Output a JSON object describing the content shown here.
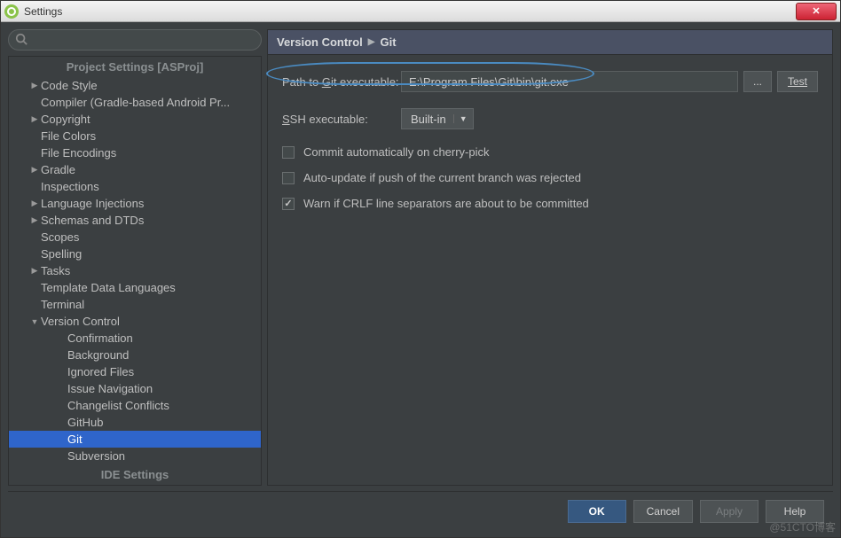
{
  "window": {
    "title": "Settings"
  },
  "search": {
    "placeholder": ""
  },
  "sidebar": {
    "section1_header": "Project Settings [ASProj]",
    "items": [
      {
        "label": "Code Style",
        "expandable": true,
        "expanded": false,
        "indent": 1
      },
      {
        "label": "Compiler (Gradle-based Android Pr...",
        "expandable": false,
        "indent": 1
      },
      {
        "label": "Copyright",
        "expandable": true,
        "expanded": false,
        "indent": 1
      },
      {
        "label": "File Colors",
        "expandable": false,
        "indent": 1
      },
      {
        "label": "File Encodings",
        "expandable": false,
        "indent": 1
      },
      {
        "label": "Gradle",
        "expandable": true,
        "expanded": false,
        "indent": 1
      },
      {
        "label": "Inspections",
        "expandable": false,
        "indent": 1
      },
      {
        "label": "Language Injections",
        "expandable": true,
        "expanded": false,
        "indent": 1
      },
      {
        "label": "Schemas and DTDs",
        "expandable": true,
        "expanded": false,
        "indent": 1
      },
      {
        "label": "Scopes",
        "expandable": false,
        "indent": 1
      },
      {
        "label": "Spelling",
        "expandable": false,
        "indent": 1
      },
      {
        "label": "Tasks",
        "expandable": true,
        "expanded": false,
        "indent": 1
      },
      {
        "label": "Template Data Languages",
        "expandable": false,
        "indent": 1
      },
      {
        "label": "Terminal",
        "expandable": false,
        "indent": 1
      },
      {
        "label": "Version Control",
        "expandable": true,
        "expanded": true,
        "indent": 1
      },
      {
        "label": "Confirmation",
        "expandable": false,
        "indent": 2
      },
      {
        "label": "Background",
        "expandable": false,
        "indent": 2
      },
      {
        "label": "Ignored Files",
        "expandable": false,
        "indent": 2
      },
      {
        "label": "Issue Navigation",
        "expandable": false,
        "indent": 2
      },
      {
        "label": "Changelist Conflicts",
        "expandable": false,
        "indent": 2
      },
      {
        "label": "GitHub",
        "expandable": false,
        "indent": 2
      },
      {
        "label": "Git",
        "expandable": false,
        "indent": 2,
        "selected": true
      },
      {
        "label": "Subversion",
        "expandable": false,
        "indent": 2
      }
    ],
    "section2_header": "IDE Settings"
  },
  "breadcrumb": {
    "part1": "Version Control",
    "part2": "Git"
  },
  "form": {
    "path_label_pre": "Path to ",
    "path_label_u": "G",
    "path_label_post": "it executable:",
    "path_value": "E:\\Program Files\\Git\\bin\\git.exe",
    "browse_label": "...",
    "test_label": "Test",
    "ssh_label_u": "S",
    "ssh_label_post": "SH executable:",
    "ssh_value": "Built-in",
    "check1": {
      "checked": false,
      "label": "Commit automatically on cherry-pick"
    },
    "check2": {
      "checked": false,
      "pre": "Auto-update if p",
      "u": "u",
      "post": "sh of the current branch was rejected"
    },
    "check3": {
      "checked": true,
      "pre": "Warn if ",
      "u": "C",
      "post": "RLF line separators are about to be committed"
    }
  },
  "buttons": {
    "ok": "OK",
    "cancel": "Cancel",
    "apply": "Apply",
    "help": "Help"
  },
  "watermark": "@51CTO博客"
}
